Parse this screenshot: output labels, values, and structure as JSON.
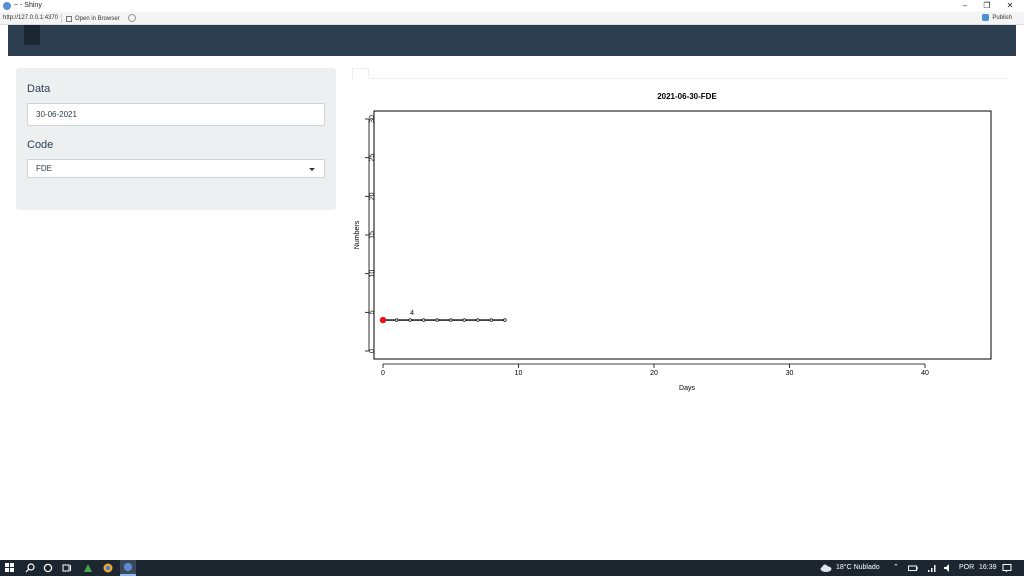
{
  "window": {
    "title": "~ - Shiny",
    "minimize": "–",
    "restore": "❐",
    "close": "✕"
  },
  "browser": {
    "url": "http://127.0.0.1:4370",
    "open_in_browser": "Open in Browser",
    "publish": "Publish"
  },
  "sidebar": {
    "date_label": "Data",
    "date_value": "30-06-2021",
    "code_label": "Code",
    "code_value": "FDE"
  },
  "chart_data": {
    "type": "line",
    "title": "2021-06-30-FDE",
    "xlabel": "Days",
    "ylabel": "Numbers",
    "xlim": [
      0,
      45
    ],
    "ylim": [
      0,
      30
    ],
    "xticks": [
      0,
      10,
      20,
      30,
      40
    ],
    "yticks": [
      0,
      5,
      10,
      15,
      20,
      25,
      30
    ],
    "series": [
      {
        "x": [
          0,
          1,
          2,
          3,
          4,
          5,
          6,
          7,
          8,
          9
        ],
        "y": [
          4,
          4,
          4,
          4,
          4,
          4,
          4,
          4,
          4,
          4
        ]
      }
    ],
    "highlight_point": {
      "x": 0,
      "y": 4,
      "color": "#e8121a"
    },
    "annotation": {
      "text": "4",
      "x": 1.7,
      "y": 4
    }
  },
  "taskbar": {
    "weather": "18°C  Nublado",
    "language": "POR",
    "time": "16:39"
  }
}
